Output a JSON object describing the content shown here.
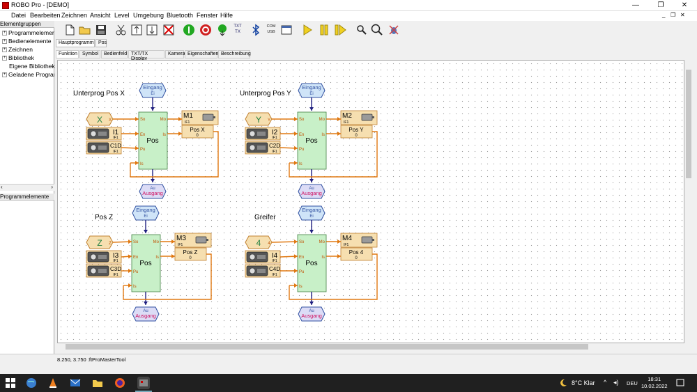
{
  "window": {
    "title": "ROBO Pro - [DEMO]",
    "min": "—",
    "max": "❐",
    "close": "✕"
  },
  "menu": [
    "Datei",
    "Bearbeiten",
    "Zeichnen",
    "Ansicht",
    "Level",
    "Umgebung",
    "Bluetooth",
    "Fenster",
    "Hilfe"
  ],
  "mdi": {
    "min": "_",
    "restore": "❐",
    "close": "✕"
  },
  "toolbar": {
    "txtx": "TXT TX",
    "com_usb": "COM USB"
  },
  "left_panel": {
    "header": "Elementgruppen",
    "items": [
      {
        "label": "Programmelemente",
        "exp": "+"
      },
      {
        "label": "Bedienelemente",
        "exp": "+"
      },
      {
        "label": "Zeichnen",
        "exp": "+"
      },
      {
        "label": "Bibliothek",
        "exp": "+"
      },
      {
        "label": "Eigene Bibliothek",
        "exp": ""
      },
      {
        "label": "Geladene Programme",
        "exp": "+"
      }
    ],
    "lower_header": "Programmelemente"
  },
  "tabs_program": [
    "Hauptprogramm",
    "Pos"
  ],
  "tabs_view": [
    "Funktion",
    "Symbol",
    "Bedienfeld",
    "TXT/TX Display",
    "Kamera",
    "Eigenschaften",
    "Beschreibung"
  ],
  "blocks": [
    {
      "title": "Unterprog Pos X",
      "var": "X",
      "var_port": "X",
      "motor": "M1",
      "motor_if": "IF1",
      "out": "Pos X",
      "out_val": "0",
      "sensor": "I1",
      "sensor_if": "IF1",
      "counter": "C1D",
      "counter_if": "IF1"
    },
    {
      "title": "Unterprog Pos Y",
      "var": "Y",
      "var_port": "Y",
      "motor": "M2",
      "motor_if": "IF1",
      "out": "Pos Y",
      "out_val": "0",
      "sensor": "I2",
      "sensor_if": "IF1",
      "counter": "C2D",
      "counter_if": "IF1"
    },
    {
      "title": "Pos Z",
      "var": "Z",
      "var_port": "Z",
      "motor": "M3",
      "motor_if": "IF1",
      "out": "Pos Z",
      "out_val": "0",
      "sensor": "I3",
      "sensor_if": "IF1",
      "counter": "C3D",
      "counter_if": "IF1"
    },
    {
      "title": "Greifer",
      "var": "4",
      "var_port": "4",
      "motor": "M4",
      "motor_if": "IF1",
      "out": "Pos 4",
      "out_val": "0",
      "sensor": "I4",
      "sensor_if": "IF1",
      "counter": "C4D",
      "counter_if": "IF1"
    }
  ],
  "sub": {
    "name": "Pos",
    "in_label": "Eingang",
    "in_sub": "Ei",
    "out_label": "Ausgang",
    "out_sub": "Au",
    "port_so": "So",
    "port_en": "En",
    "port_pu": "Pu",
    "port_is": "Is",
    "port_mo": "Mo",
    "port_is_out": "Is"
  },
  "status": "8.250, 3.750 :ftProMasterTool",
  "taskbar": {
    "weather": "8°C  Klar",
    "lang": "DEU",
    "time": "18:31",
    "date": "10.02.2022"
  },
  "colors": {
    "sub_fill": "#c8f0c8",
    "orange_fill": "#f6dfb0",
    "wire": "#e07810",
    "blue_wire": "#202080",
    "eingang_fill": "#cfe4f8",
    "ausgang_fill": "#dcdcf6"
  }
}
